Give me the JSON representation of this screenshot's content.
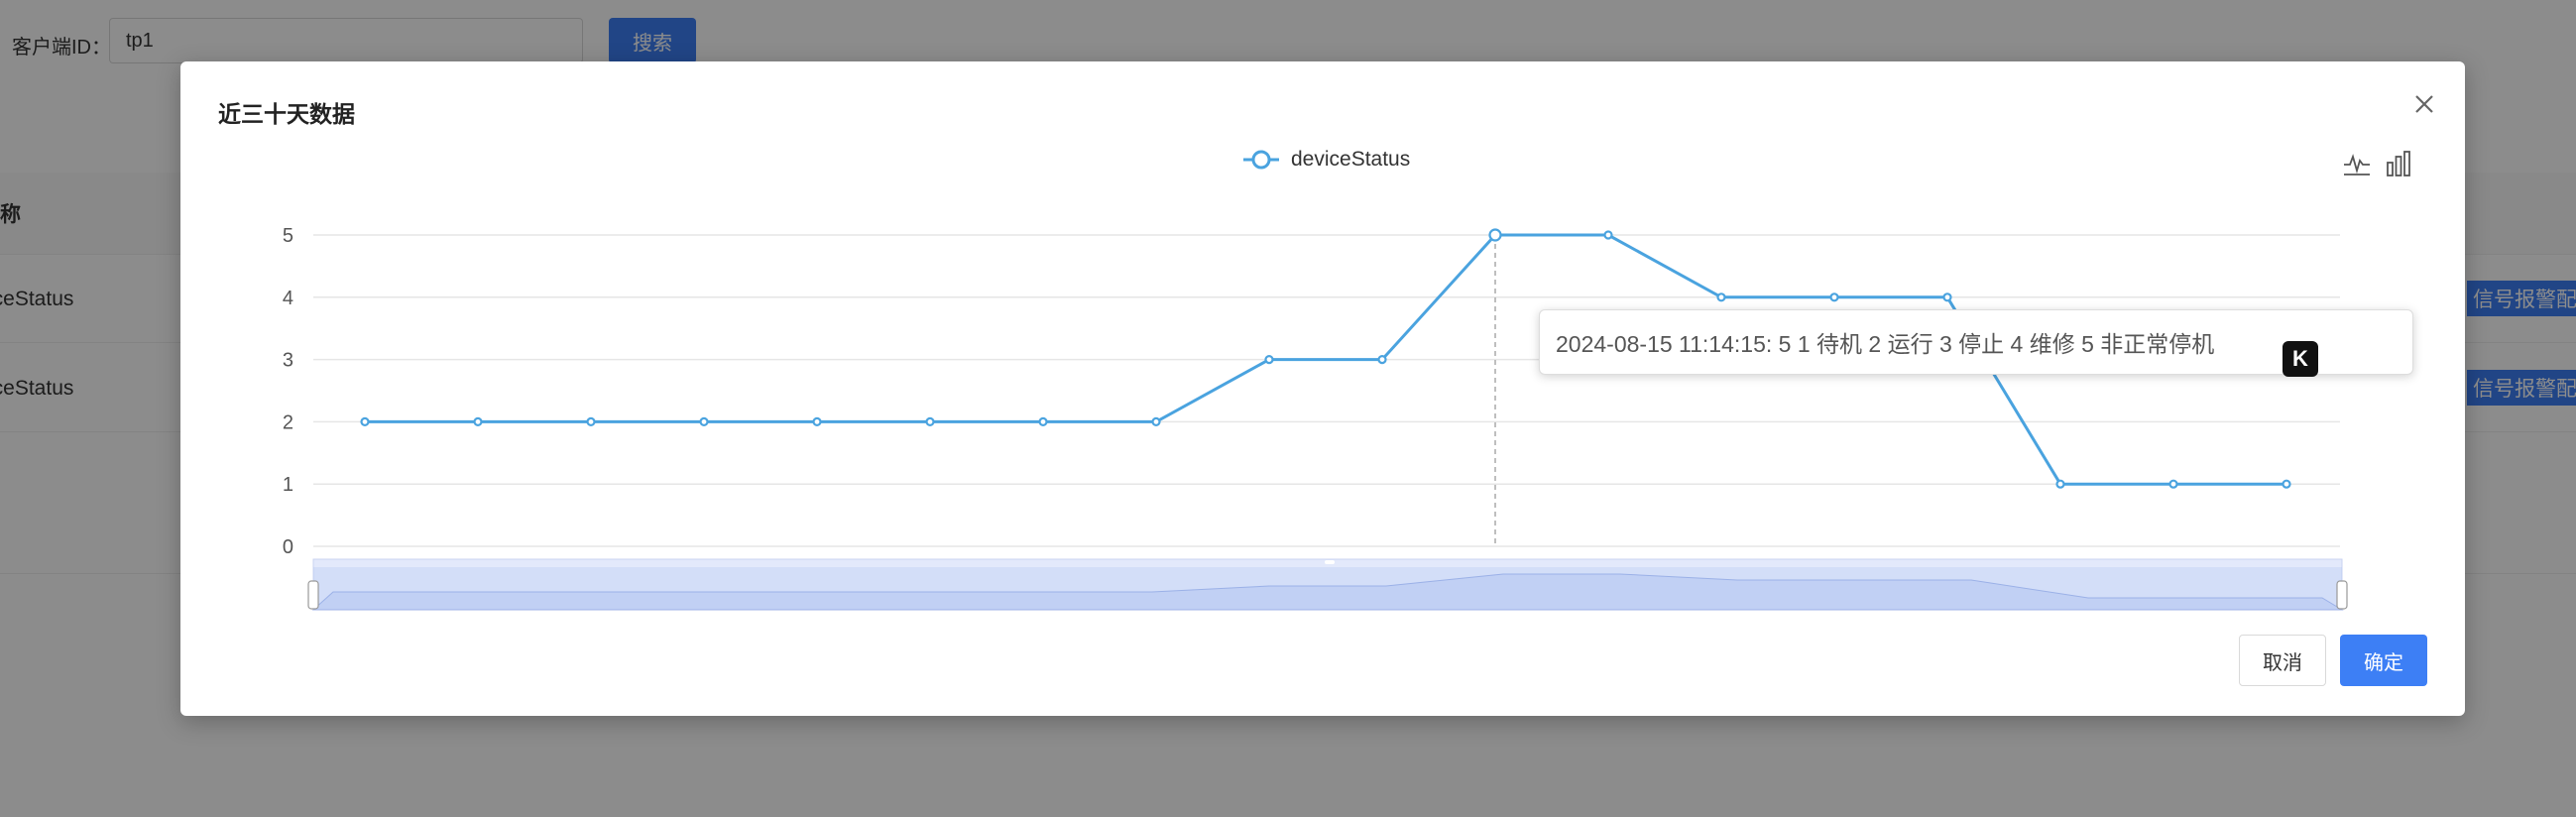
{
  "background": {
    "search_label": "客户端ID：",
    "search_value": "tp1",
    "search_button": "搜索",
    "table_header_fragment": "称",
    "rows": [
      {
        "name": "iceStatus",
        "action": "信号报警配置"
      },
      {
        "name": "iceStatus",
        "action": "信号报警配置"
      }
    ]
  },
  "modal": {
    "title": "近三十天数据",
    "legend": "deviceStatus",
    "tooltip": "2024-08-15 11:14:15: 5 1 待机 2 运行 3 停止 4 维修 5 非正常停机",
    "badge": "K",
    "cancel": "取消",
    "ok": "确定",
    "icons": {
      "close": "close-icon",
      "line_toggle": "line-chart-icon",
      "bar_toggle": "bar-chart-icon"
    }
  },
  "colors": {
    "series": "#4aa3df",
    "primary": "#3d7ff5"
  },
  "chart_data": {
    "type": "line",
    "series": [
      {
        "name": "deviceStatus",
        "values": [
          2,
          2,
          2,
          2,
          2,
          2,
          2,
          2,
          3,
          3,
          5,
          5,
          4,
          4,
          4,
          1,
          1,
          1
        ]
      }
    ],
    "ylim": [
      0,
      5
    ],
    "yticks": [
      "0",
      "1",
      "2",
      "3",
      "4",
      "5"
    ],
    "highlighted_index": 10,
    "legend_position": "top-center",
    "grid": true,
    "datazoom": true
  }
}
